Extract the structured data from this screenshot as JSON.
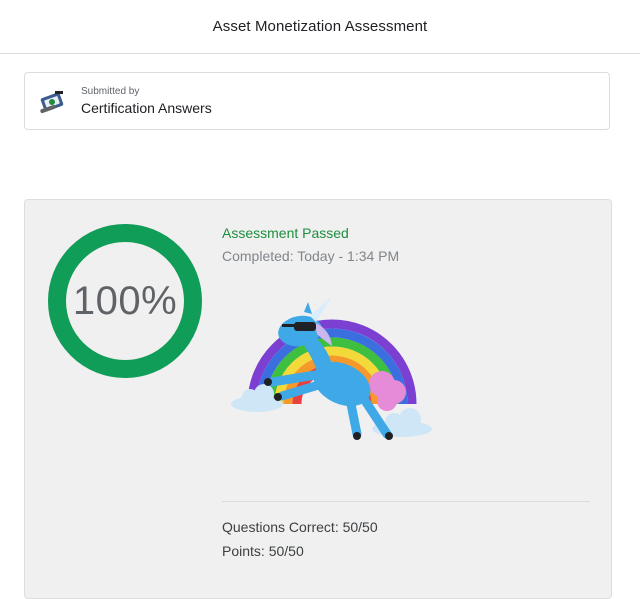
{
  "header": {
    "title": "Asset Monetization Assessment"
  },
  "submission": {
    "label": "Submitted by",
    "name": "Certification Answers",
    "avatar_icon": "certificate-avatar-icon"
  },
  "result": {
    "score_percent_label": "100%",
    "score_fraction": 1.0,
    "ring_color": "#0f9d58",
    "status": "Assessment Passed",
    "status_color": "#1e8e3e",
    "completed": "Completed: Today - 1:34 PM",
    "illustration": "rainbow-unicorn-illustration",
    "questions_correct": "Questions Correct: 50/50",
    "points": "Points: 50/50"
  }
}
